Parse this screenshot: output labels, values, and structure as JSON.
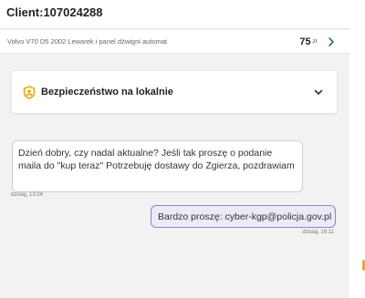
{
  "header": {
    "client_label": "Client:107024288"
  },
  "offer": {
    "title": "Volvo V70 D5 2002 Lewarek i panel dźwigni automat",
    "price": "75",
    "currency": "zł",
    "chevron_icon": "chevron-right-icon"
  },
  "security": {
    "label": "Bezpieczeństwo na lokalnie",
    "icon": "shield-icon",
    "expand_icon": "chevron-down-icon"
  },
  "messages": [
    {
      "direction": "incoming",
      "text": "Dzień dobry, czy nadal aktualne? Jeśli tak proszę o podanie maila do \"kup teraz\" Potrzebuję dostawy do Zgierza, pozdrawiam",
      "time": "dzisiaj, 13:24"
    },
    {
      "direction": "outgoing",
      "text": "Bardzo proszę: cyber-kgp@policja.gov.pl",
      "time": "dzisiaj, 16:11"
    }
  ],
  "colors": {
    "accent": "#2f6f76",
    "shield": "#e0a000",
    "outgoing_bubble": "#eceaf7",
    "outgoing_border": "#8d86c9"
  }
}
